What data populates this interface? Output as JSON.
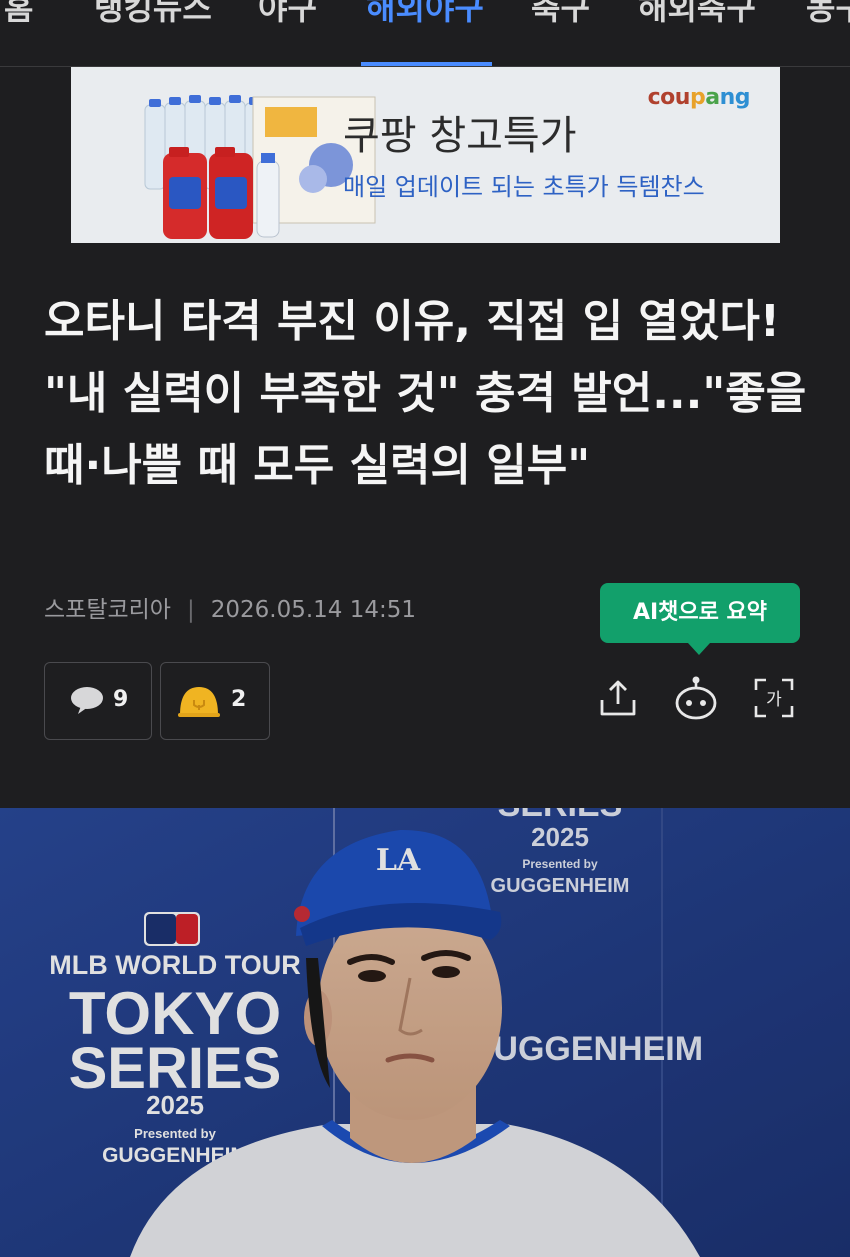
{
  "nav": {
    "items": [
      "홈",
      "랭킹뉴스",
      "야구",
      "해외야구",
      "축구",
      "해외축구",
      "농구"
    ],
    "active": "해외야구",
    "accent_color": "#4a8cff"
  },
  "ad": {
    "brand": "coupang",
    "title": "쿠팡 창고특가",
    "subtitle": "매일 업데이트 되는 초특가 득템찬스",
    "subtitle_color": "#2e62c4"
  },
  "article": {
    "headline": "오타니 타격 부진 이유, 직접 입 열었다! \"내 실력이 부족한 것\" 충격 발언...\"좋을 때·나쁠 때 모두 실력의 일부\"",
    "source": "스포탈코리아",
    "separator": "|",
    "datetime": "2026.05.14 14:51",
    "ai_summary_label": "AI챗으로 요약",
    "ai_color": "#12a06b",
    "comment_count": "9",
    "reaction_count": "2"
  },
  "photo": {
    "backdrop_text": {
      "event_line": "MLB WORLD TOUR",
      "title_1": "TOKYO",
      "title_2": "SERIES",
      "year": "2025",
      "presented": "Presented by",
      "sponsor": "GUGGENHEIM",
      "top_word": "SERIES",
      "cap_logo": "LA"
    }
  }
}
